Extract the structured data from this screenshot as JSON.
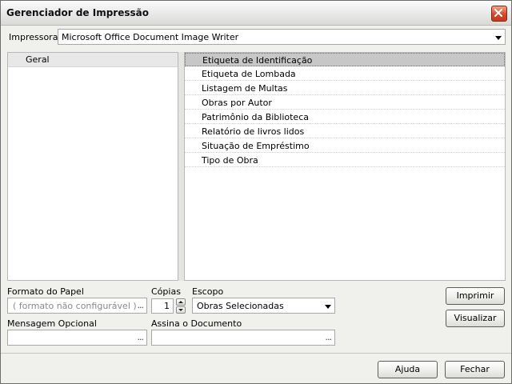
{
  "window": {
    "title": "Gerenciador de Impressão"
  },
  "printer": {
    "label": "Impressora",
    "value": "Microsoft Office Document Image Writer"
  },
  "categories": [
    {
      "label": "Geral"
    }
  ],
  "reports": [
    {
      "label": "Etiqueta de Identificação",
      "selected": true
    },
    {
      "label": "Etiqueta de Lombada",
      "selected": false
    },
    {
      "label": "Listagem de Multas",
      "selected": false
    },
    {
      "label": "Obras por Autor",
      "selected": false
    },
    {
      "label": "Patrimônio da Biblioteca",
      "selected": false
    },
    {
      "label": "Relatório de livros lidos",
      "selected": false
    },
    {
      "label": "Situação de Empréstimo",
      "selected": false
    },
    {
      "label": "Tipo de Obra",
      "selected": false
    }
  ],
  "paper_format": {
    "label": "Formato do Papel",
    "placeholder": "( formato não configurável )",
    "browse": "..."
  },
  "copies": {
    "label": "Cópias",
    "value": "1"
  },
  "scope": {
    "label": "Escopo",
    "value": "Obras Selecionadas"
  },
  "optional_message": {
    "label": "Mensagem Opcional",
    "value": "",
    "browse": "..."
  },
  "sign_document": {
    "label": "Assina o Documento",
    "value": "",
    "browse": "..."
  },
  "buttons": {
    "print": "Imprimir",
    "preview": "Visualizar",
    "help": "Ajuda",
    "close": "Fechar"
  }
}
